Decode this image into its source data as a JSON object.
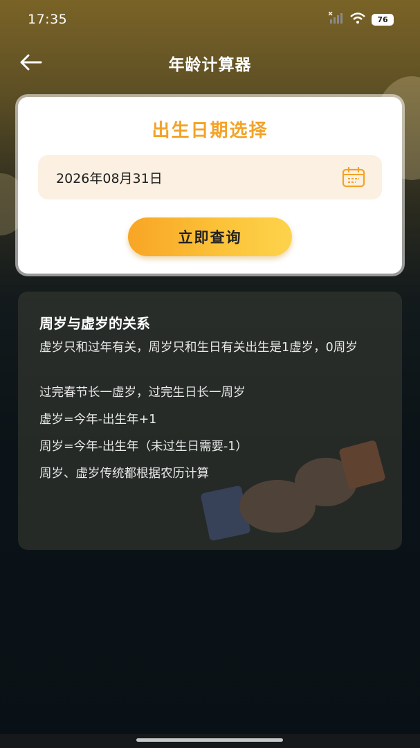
{
  "status_bar": {
    "time": "17:35",
    "battery": "76"
  },
  "nav": {
    "title": "年龄计算器"
  },
  "card": {
    "title": "出生日期选择",
    "date_value": "2026年08月31日",
    "query_label": "立即查询"
  },
  "info": {
    "title": "周岁与虚岁的关系",
    "lines": [
      "虚岁只和过年有关，周岁只和生日有关出生是1虚岁，0周岁",
      "过完春节长一虚岁，过完生日长一周岁",
      "虚岁=今年-出生年+1",
      "周岁=今年-出生年（未过生日需要-1）",
      "周岁、虚岁传统都根据农历计算"
    ]
  },
  "colors": {
    "accent_orange": "#f3a328",
    "button_gradient_start": "#f8a524",
    "button_gradient_end": "#fdd34c",
    "date_field_bg": "#fbf0e1"
  }
}
